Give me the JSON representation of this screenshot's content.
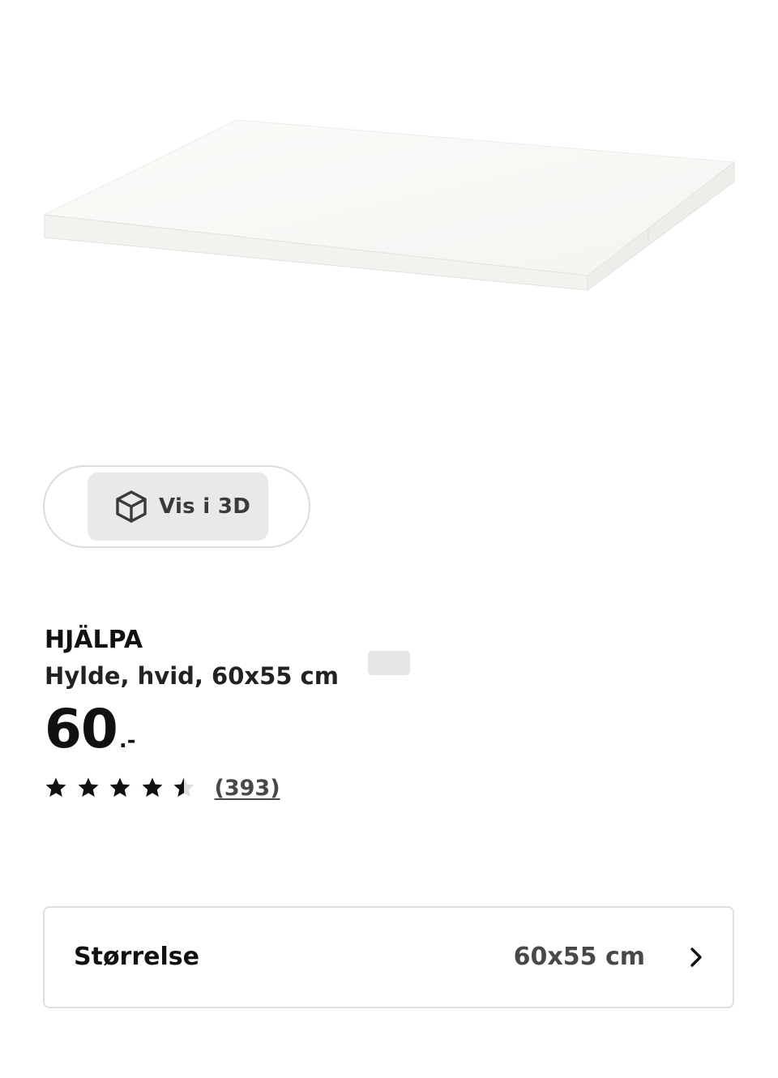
{
  "product": {
    "image_alt": "HJÄLPA Hylde, hvid, 60x55 cm",
    "name": "HJÄLPA",
    "description": "Hylde, hvid, 60x55 cm",
    "price_integer": "60",
    "price_suffix": ".-"
  },
  "view_3d": {
    "label": "Vis i 3D",
    "icon": "cube-icon"
  },
  "rating": {
    "value": 4.5,
    "max": 5,
    "review_count_text": "(393)",
    "star_color": "#111111",
    "empty_star_color": "#dddddd"
  },
  "size_selector": {
    "label": "Størrelse",
    "value": "60x55 cm",
    "icon": "chevron-right-icon"
  }
}
